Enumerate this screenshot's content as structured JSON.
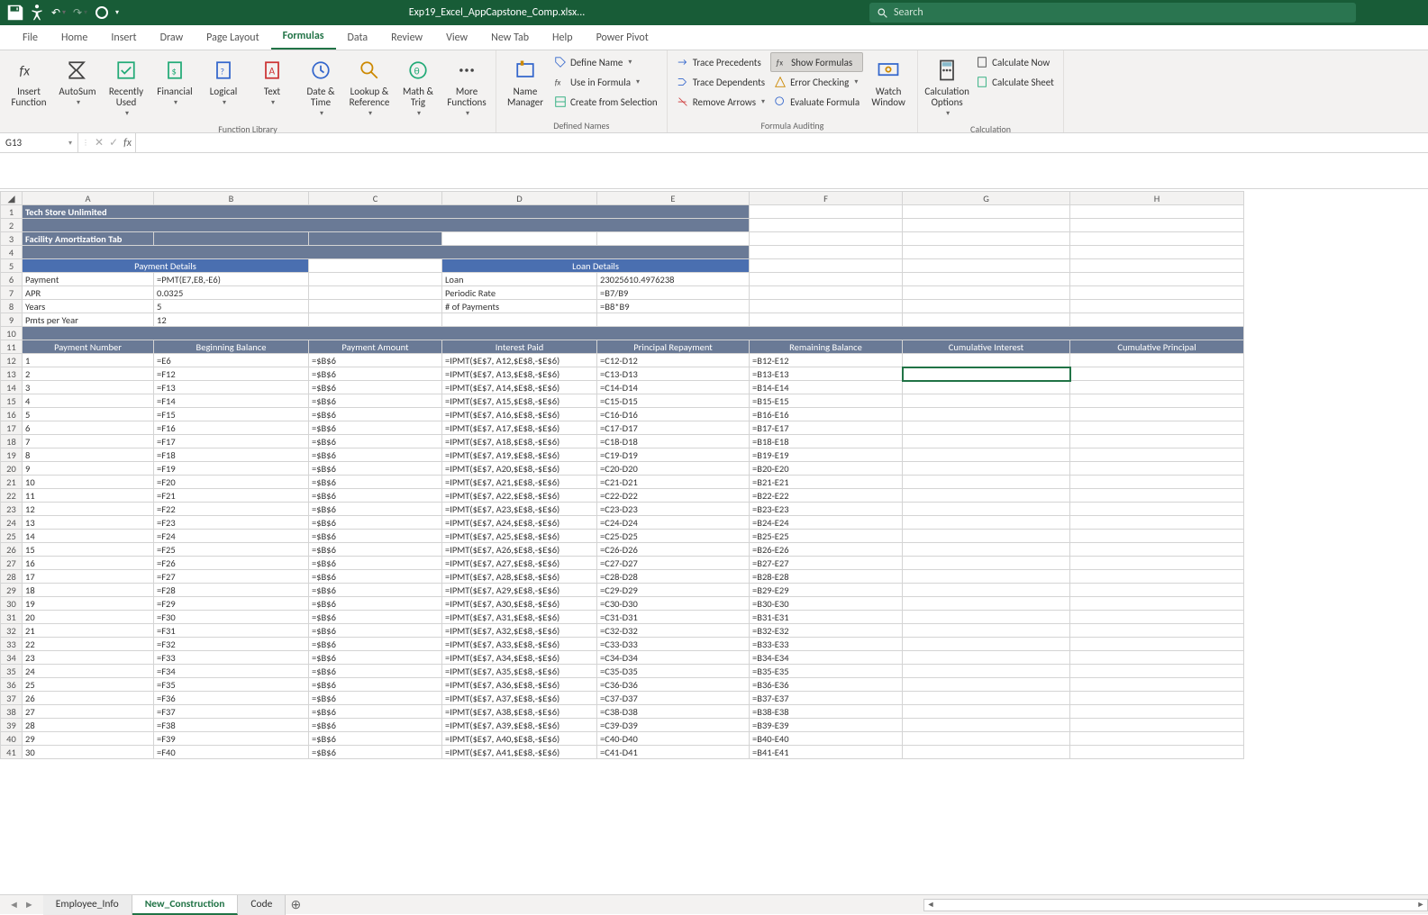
{
  "title": "Exp19_Excel_AppCapstone_Comp.xlsx...",
  "search_placeholder": "Search",
  "tabs": [
    "File",
    "Home",
    "Insert",
    "Draw",
    "Page Layout",
    "Formulas",
    "Data",
    "Review",
    "View",
    "New Tab",
    "Help",
    "Power Pivot"
  ],
  "active_tab": "Formulas",
  "groups": {
    "fn_lib": "Function Library",
    "defined": "Defined Names",
    "audit": "Formula Auditing",
    "calc": "Calculation"
  },
  "btns": {
    "insert_function": "Insert Function",
    "autosum": "AutoSum",
    "recently": "Recently Used",
    "financial": "Financial",
    "logical": "Logical",
    "text": "Text",
    "datetime": "Date & Time",
    "lookup": "Lookup & Reference",
    "mathtrig": "Math & Trig",
    "more": "More Functions",
    "name_mgr": "Name Manager",
    "define_name": "Define Name",
    "use_formula": "Use in Formula",
    "create_sel": "Create from Selection",
    "trace_prec": "Trace Precedents",
    "trace_dep": "Trace Dependents",
    "remove_arrows": "Remove Arrows",
    "show_formulas": "Show Formulas",
    "error_check": "Error Checking",
    "eval_formula": "Evaluate Formula",
    "watch": "Watch Window",
    "calc_opts": "Calculation Options",
    "calc_now": "Calculate Now",
    "calc_sheet": "Calculate Sheet"
  },
  "name_box": "G13",
  "formula_bar": "",
  "columns": [
    "A",
    "B",
    "C",
    "D",
    "E",
    "F",
    "G",
    "H"
  ],
  "title_rows": {
    "r1": "Tech Store Unlimited",
    "r3": "Facility Amortization Tab"
  },
  "section_headers": {
    "payment_details": "Payment Details",
    "loan_details": "Loan Details"
  },
  "loan_block": {
    "payment_label": "Payment",
    "payment_val": "=PMT(E7,E8,-E6)",
    "apr_label": "APR",
    "apr_val": "0.0325",
    "years_label": "Years",
    "years_val": "5",
    "pmtsyr_label": "Pmts per Year",
    "pmtsyr_val": "12",
    "loan_label": "Loan",
    "loan_val": "23025610.4976238",
    "rate_label": "Periodic Rate",
    "rate_val": "=B7/B9",
    "npmts_label": "# of Payments",
    "npmts_val": "=B8*B9"
  },
  "table_headers": [
    "Payment Number",
    "Beginning Balance",
    "Payment Amount",
    "Interest Paid",
    "Principal Repayment",
    "Remaining Balance",
    "Cumulative Interest",
    "Cumulative Principal"
  ],
  "sheets": [
    "Employee_Info",
    "New_Construction",
    "Code"
  ],
  "active_sheet": "New_Construction",
  "chart_data": null,
  "amort_rows": [
    {
      "r": 12,
      "n": "1",
      "b": "=E6",
      "c": "=$B$6",
      "d": "=IPMT($E$7, A12,$E$8,-$E$6)",
      "e": "=C12-D12",
      "f": "=B12-E12"
    },
    {
      "r": 13,
      "n": "2",
      "b": "=F12",
      "c": "=$B$6",
      "d": "=IPMT($E$7, A13,$E$8,-$E$6)",
      "e": "=C13-D13",
      "f": "=B13-E13"
    },
    {
      "r": 14,
      "n": "3",
      "b": "=F13",
      "c": "=$B$6",
      "d": "=IPMT($E$7, A14,$E$8,-$E$6)",
      "e": "=C14-D14",
      "f": "=B14-E14"
    },
    {
      "r": 15,
      "n": "4",
      "b": "=F14",
      "c": "=$B$6",
      "d": "=IPMT($E$7, A15,$E$8,-$E$6)",
      "e": "=C15-D15",
      "f": "=B15-E15"
    },
    {
      "r": 16,
      "n": "5",
      "b": "=F15",
      "c": "=$B$6",
      "d": "=IPMT($E$7, A16,$E$8,-$E$6)",
      "e": "=C16-D16",
      "f": "=B16-E16"
    },
    {
      "r": 17,
      "n": "6",
      "b": "=F16",
      "c": "=$B$6",
      "d": "=IPMT($E$7, A17,$E$8,-$E$6)",
      "e": "=C17-D17",
      "f": "=B17-E17"
    },
    {
      "r": 18,
      "n": "7",
      "b": "=F17",
      "c": "=$B$6",
      "d": "=IPMT($E$7, A18,$E$8,-$E$6)",
      "e": "=C18-D18",
      "f": "=B18-E18"
    },
    {
      "r": 19,
      "n": "8",
      "b": "=F18",
      "c": "=$B$6",
      "d": "=IPMT($E$7, A19,$E$8,-$E$6)",
      "e": "=C19-D19",
      "f": "=B19-E19"
    },
    {
      "r": 20,
      "n": "9",
      "b": "=F19",
      "c": "=$B$6",
      "d": "=IPMT($E$7, A20,$E$8,-$E$6)",
      "e": "=C20-D20",
      "f": "=B20-E20"
    },
    {
      "r": 21,
      "n": "10",
      "b": "=F20",
      "c": "=$B$6",
      "d": "=IPMT($E$7, A21,$E$8,-$E$6)",
      "e": "=C21-D21",
      "f": "=B21-E21"
    },
    {
      "r": 22,
      "n": "11",
      "b": "=F21",
      "c": "=$B$6",
      "d": "=IPMT($E$7, A22,$E$8,-$E$6)",
      "e": "=C22-D22",
      "f": "=B22-E22"
    },
    {
      "r": 23,
      "n": "12",
      "b": "=F22",
      "c": "=$B$6",
      "d": "=IPMT($E$7, A23,$E$8,-$E$6)",
      "e": "=C23-D23",
      "f": "=B23-E23"
    },
    {
      "r": 24,
      "n": "13",
      "b": "=F23",
      "c": "=$B$6",
      "d": "=IPMT($E$7, A24,$E$8,-$E$6)",
      "e": "=C24-D24",
      "f": "=B24-E24"
    },
    {
      "r": 25,
      "n": "14",
      "b": "=F24",
      "c": "=$B$6",
      "d": "=IPMT($E$7, A25,$E$8,-$E$6)",
      "e": "=C25-D25",
      "f": "=B25-E25"
    },
    {
      "r": 26,
      "n": "15",
      "b": "=F25",
      "c": "=$B$6",
      "d": "=IPMT($E$7, A26,$E$8,-$E$6)",
      "e": "=C26-D26",
      "f": "=B26-E26"
    },
    {
      "r": 27,
      "n": "16",
      "b": "=F26",
      "c": "=$B$6",
      "d": "=IPMT($E$7, A27,$E$8,-$E$6)",
      "e": "=C27-D27",
      "f": "=B27-E27"
    },
    {
      "r": 28,
      "n": "17",
      "b": "=F27",
      "c": "=$B$6",
      "d": "=IPMT($E$7, A28,$E$8,-$E$6)",
      "e": "=C28-D28",
      "f": "=B28-E28"
    },
    {
      "r": 29,
      "n": "18",
      "b": "=F28",
      "c": "=$B$6",
      "d": "=IPMT($E$7, A29,$E$8,-$E$6)",
      "e": "=C29-D29",
      "f": "=B29-E29"
    },
    {
      "r": 30,
      "n": "19",
      "b": "=F29",
      "c": "=$B$6",
      "d": "=IPMT($E$7, A30,$E$8,-$E$6)",
      "e": "=C30-D30",
      "f": "=B30-E30"
    },
    {
      "r": 31,
      "n": "20",
      "b": "=F30",
      "c": "=$B$6",
      "d": "=IPMT($E$7, A31,$E$8,-$E$6)",
      "e": "=C31-D31",
      "f": "=B31-E31"
    },
    {
      "r": 32,
      "n": "21",
      "b": "=F31",
      "c": "=$B$6",
      "d": "=IPMT($E$7, A32,$E$8,-$E$6)",
      "e": "=C32-D32",
      "f": "=B32-E32"
    },
    {
      "r": 33,
      "n": "22",
      "b": "=F32",
      "c": "=$B$6",
      "d": "=IPMT($E$7, A33,$E$8,-$E$6)",
      "e": "=C33-D33",
      "f": "=B33-E33"
    },
    {
      "r": 34,
      "n": "23",
      "b": "=F33",
      "c": "=$B$6",
      "d": "=IPMT($E$7, A34,$E$8,-$E$6)",
      "e": "=C34-D34",
      "f": "=B34-E34"
    },
    {
      "r": 35,
      "n": "24",
      "b": "=F34",
      "c": "=$B$6",
      "d": "=IPMT($E$7, A35,$E$8,-$E$6)",
      "e": "=C35-D35",
      "f": "=B35-E35"
    },
    {
      "r": 36,
      "n": "25",
      "b": "=F35",
      "c": "=$B$6",
      "d": "=IPMT($E$7, A36,$E$8,-$E$6)",
      "e": "=C36-D36",
      "f": "=B36-E36"
    },
    {
      "r": 37,
      "n": "26",
      "b": "=F36",
      "c": "=$B$6",
      "d": "=IPMT($E$7, A37,$E$8,-$E$6)",
      "e": "=C37-D37",
      "f": "=B37-E37"
    },
    {
      "r": 38,
      "n": "27",
      "b": "=F37",
      "c": "=$B$6",
      "d": "=IPMT($E$7, A38,$E$8,-$E$6)",
      "e": "=C38-D38",
      "f": "=B38-E38"
    },
    {
      "r": 39,
      "n": "28",
      "b": "=F38",
      "c": "=$B$6",
      "d": "=IPMT($E$7, A39,$E$8,-$E$6)",
      "e": "=C39-D39",
      "f": "=B39-E39"
    },
    {
      "r": 40,
      "n": "29",
      "b": "=F39",
      "c": "=$B$6",
      "d": "=IPMT($E$7, A40,$E$8,-$E$6)",
      "e": "=C40-D40",
      "f": "=B40-E40"
    },
    {
      "r": 41,
      "n": "30",
      "b": "=F40",
      "c": "=$B$6",
      "d": "=IPMT($E$7, A41,$E$8,-$E$6)",
      "e": "=C41-D41",
      "f": "=B41-E41"
    }
  ]
}
